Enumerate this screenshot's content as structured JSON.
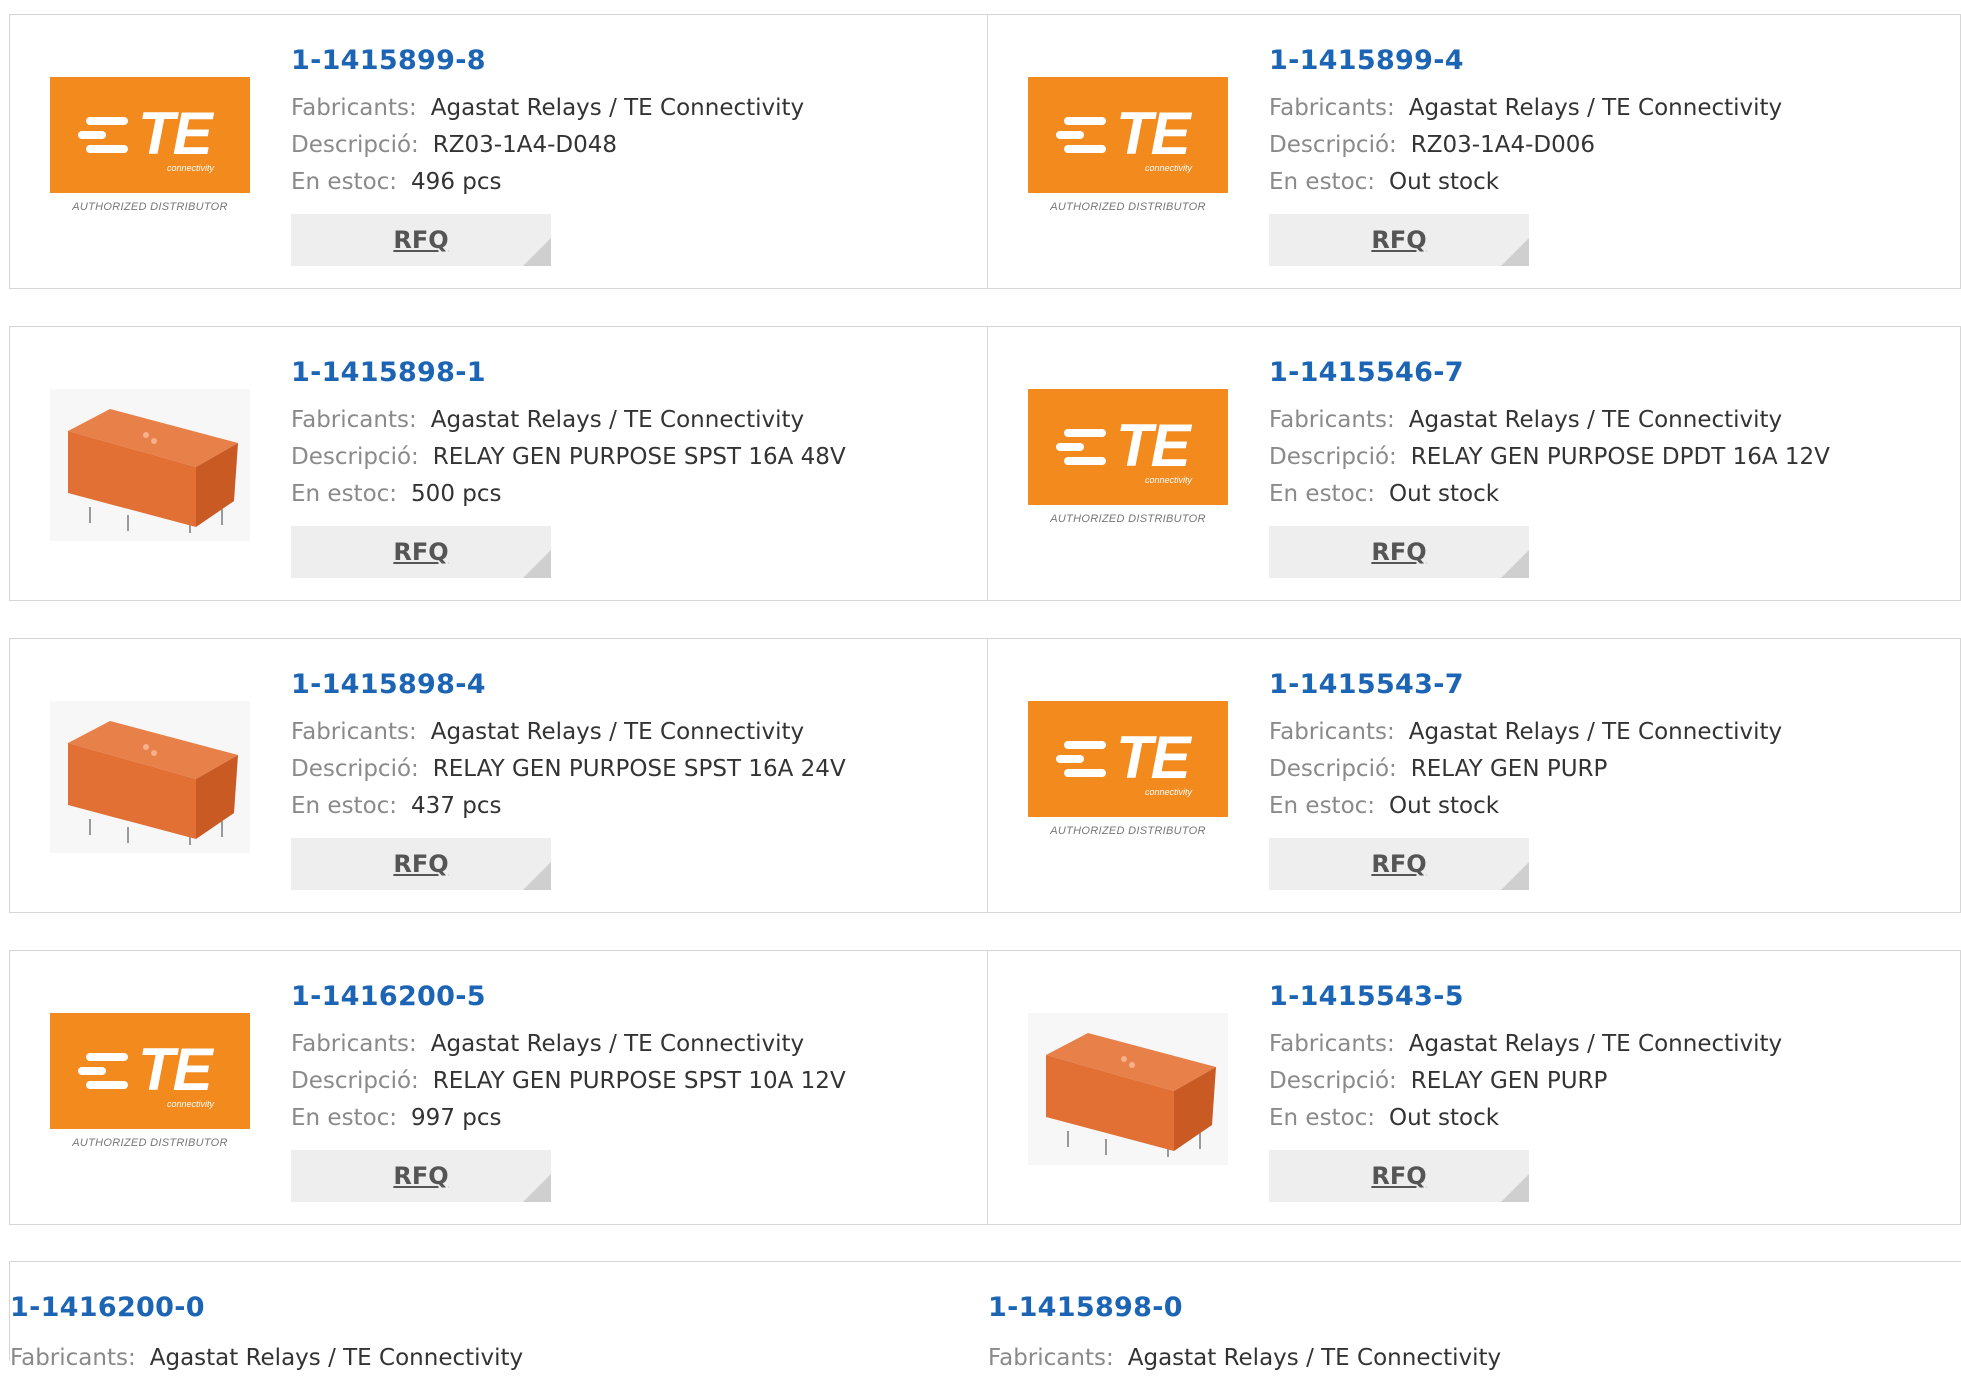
{
  "labels": {
    "manufacturer": "Fabricants:",
    "description": "Descripció:",
    "stock": "En estoc:",
    "rfq": "RFQ"
  },
  "logo": {
    "brand": "TE",
    "sub": "connectivity",
    "authorized": "AUTHORIZED DISTRIBUTOR",
    "color": "#f28a1d"
  },
  "colors": {
    "link": "#1c64b4",
    "label": "#8a8a8a"
  },
  "rows": [
    {
      "left": {
        "part": "1-1415899-8",
        "manufacturer": "Agastat Relays / TE Connectivity",
        "description": "RZ03-1A4-D048",
        "stock": "496 pcs",
        "image": "te-logo"
      },
      "right": {
        "part": "1-1415899-4",
        "manufacturer": "Agastat Relays / TE Connectivity",
        "description": "RZ03-1A4-D006",
        "stock": "Out stock",
        "image": "te-logo"
      }
    },
    {
      "left": {
        "part": "1-1415898-1",
        "manufacturer": "Agastat Relays / TE Connectivity",
        "description": "RELAY GEN PURPOSE SPST 16A 48V",
        "stock": "500 pcs",
        "image": "relay-photo"
      },
      "right": {
        "part": "1-1415546-7",
        "manufacturer": "Agastat Relays / TE Connectivity",
        "description": "RELAY GEN PURPOSE DPDT 16A 12V",
        "stock": "Out stock",
        "image": "te-logo"
      }
    },
    {
      "left": {
        "part": "1-1415898-4",
        "manufacturer": "Agastat Relays / TE Connectivity",
        "description": "RELAY GEN PURPOSE SPST 16A 24V",
        "stock": "437 pcs",
        "image": "relay-photo"
      },
      "right": {
        "part": "1-1415543-7",
        "manufacturer": "Agastat Relays / TE Connectivity",
        "description": "RELAY GEN PURP",
        "stock": "Out stock",
        "image": "te-logo"
      }
    },
    {
      "left": {
        "part": "1-1416200-5",
        "manufacturer": "Agastat Relays / TE Connectivity",
        "description": "RELAY GEN PURPOSE SPST 10A 12V",
        "stock": "997 pcs",
        "image": "te-logo"
      },
      "right": {
        "part": "1-1415543-5",
        "manufacturer": "Agastat Relays / TE Connectivity",
        "description": "RELAY GEN PURP",
        "stock": "Out stock",
        "image": "relay-photo"
      }
    }
  ],
  "bottom": {
    "left": {
      "part": "1-1416200-0",
      "manufacturer": "Agastat Relays / TE Connectivity"
    },
    "right": {
      "part": "1-1415898-0",
      "manufacturer": "Agastat Relays / TE Connectivity"
    }
  }
}
